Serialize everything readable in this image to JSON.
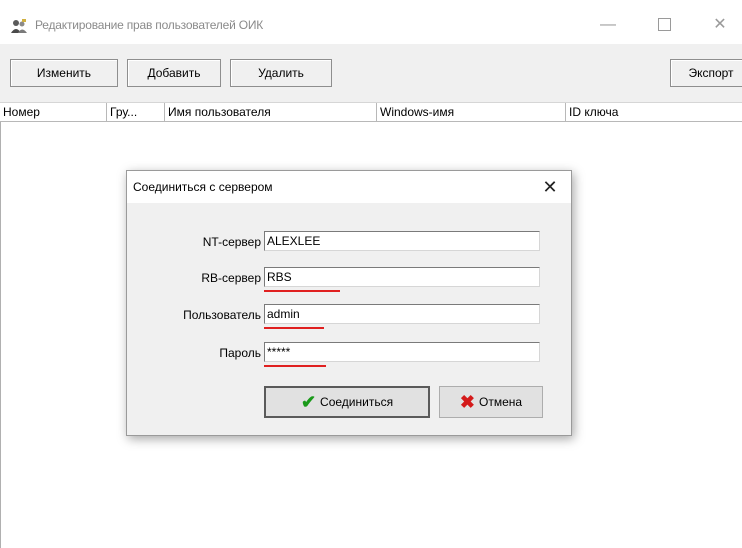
{
  "window": {
    "title": "Редактирование прав пользователей ОИК",
    "minimize": "—",
    "close": "✕"
  },
  "toolbar": {
    "edit_label": "Изменить",
    "add_label": "Добавить",
    "delete_label": "Удалить",
    "export_label": "Экспорт"
  },
  "table": {
    "columns": [
      "Номер",
      "Гру...",
      "Имя пользователя",
      "Windows-имя",
      "ID ключа"
    ]
  },
  "dialog": {
    "title": "Соединиться с сервером",
    "close": "✕",
    "fields": [
      {
        "label": "NT-сервер",
        "value": "ALEXLEE"
      },
      {
        "label": "RB-сервер",
        "value": "RBS"
      },
      {
        "label": "Пользователь",
        "value": "admin"
      },
      {
        "label": "Пароль",
        "value": "*****"
      }
    ],
    "connect_label": "Соединиться",
    "cancel_label": "Отмена"
  },
  "colors": {
    "highlight_underline": "#e02020",
    "check_icon": "#1a9a1a",
    "cancel_icon": "#d41a1a"
  }
}
